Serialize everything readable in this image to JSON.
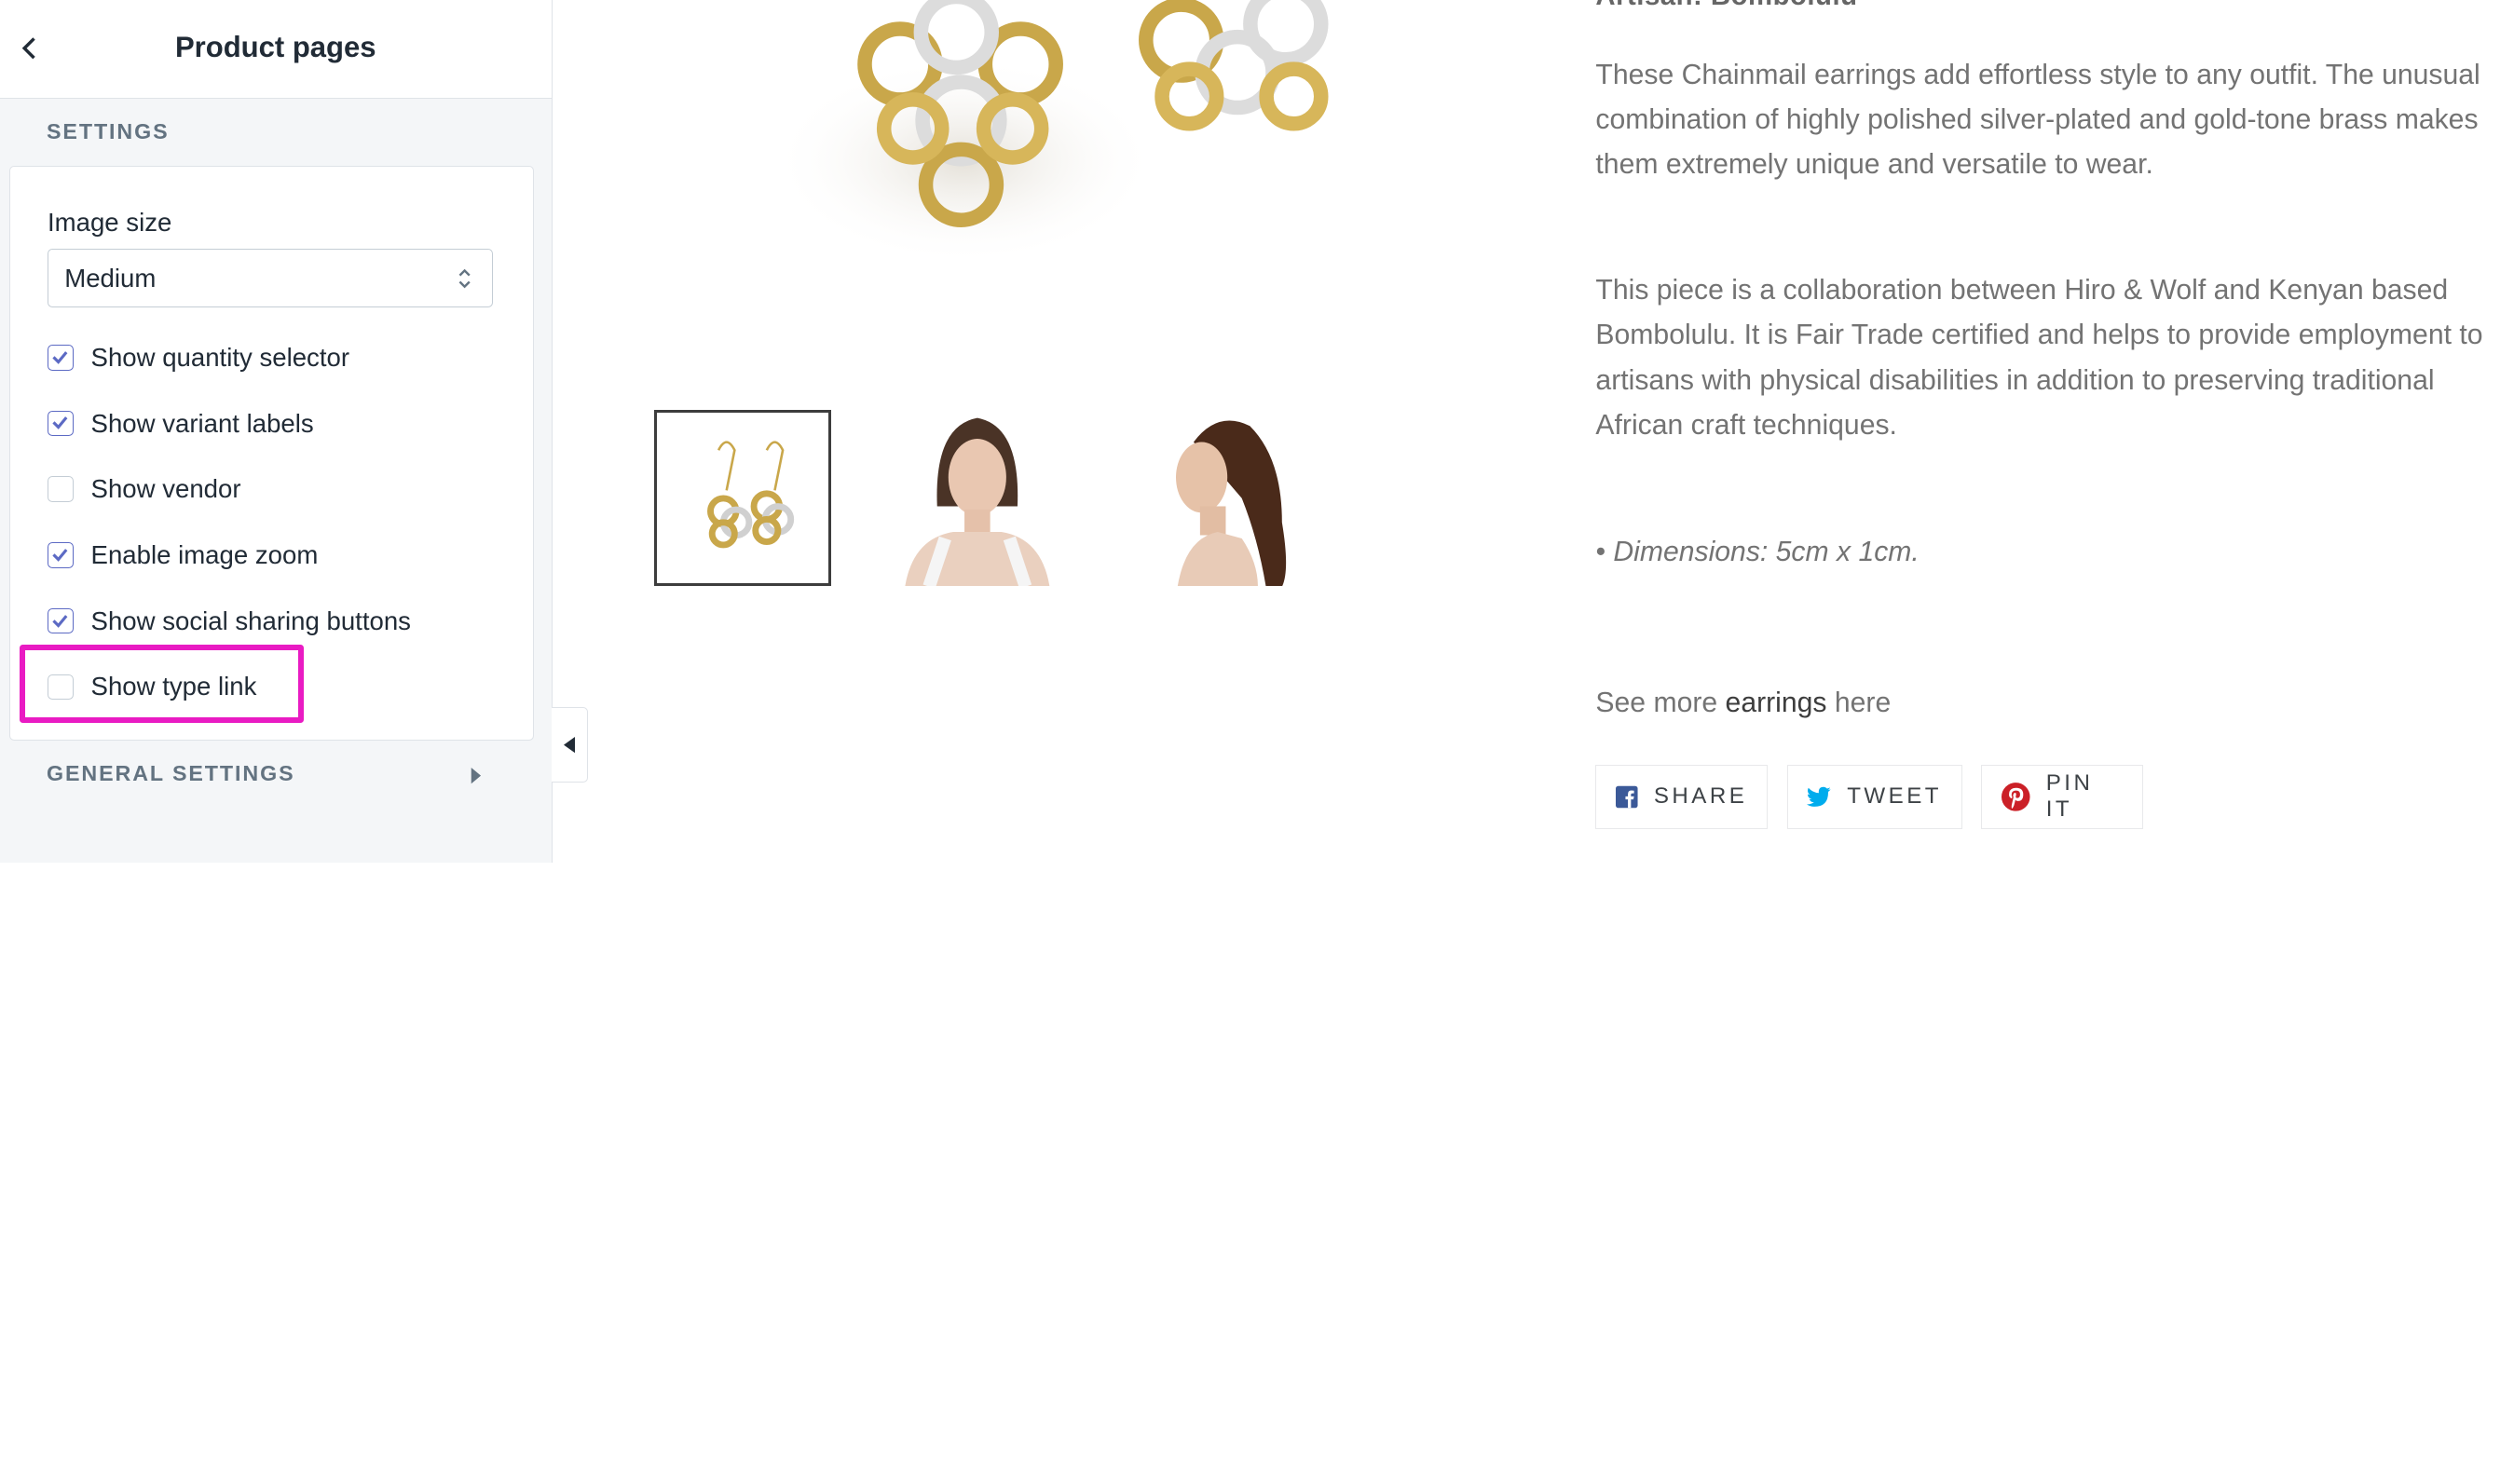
{
  "sidebar": {
    "title": "Product pages",
    "section_title": "SETTINGS",
    "image_size": {
      "label": "Image size",
      "value": "Medium"
    },
    "checkboxes": [
      {
        "label": "Show quantity selector",
        "checked": true
      },
      {
        "label": "Show variant labels",
        "checked": true
      },
      {
        "label": "Show vendor",
        "checked": false
      },
      {
        "label": "Enable image zoom",
        "checked": true
      },
      {
        "label": "Show social sharing buttons",
        "checked": true
      },
      {
        "label": "Show type link",
        "checked": false
      }
    ],
    "general_settings": "GENERAL SETTINGS"
  },
  "product": {
    "title_partial": "Artisan: Bombolulu",
    "description": [
      "These Chainmail earrings add effortless style to any outfit. The unusual combination of highly polished silver-plated and gold-tone brass makes them extremely unique and versatile to wear.",
      "This piece is a collaboration between Hiro & Wolf and Kenyan based Bombolulu. It is Fair Trade certified and helps to provide employment to artisans with physical disabilities in addition to preserving traditional African craft techniques.",
      "• Dimensions: 5cm x 1cm."
    ],
    "see_more": {
      "prefix": "See more ",
      "link": "earrings",
      "suffix": " here"
    },
    "share": [
      {
        "label": "SHARE",
        "icon": "facebook-icon",
        "color": "#3b5998"
      },
      {
        "label": "TWEET",
        "icon": "twitter-icon",
        "color": "#00aced"
      },
      {
        "label": "PIN IT",
        "icon": "pinterest-icon",
        "color": "#cb2027"
      }
    ]
  },
  "colors": {
    "accent": "#5c6ac4",
    "highlight": "#e91bc3",
    "sidebar_bg": "#f4f6f8"
  }
}
